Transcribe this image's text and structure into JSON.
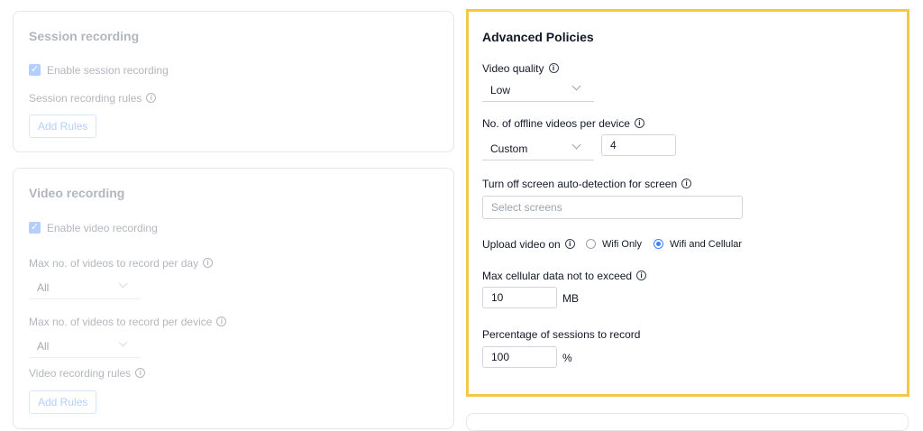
{
  "session_recording": {
    "title": "Session recording",
    "enable_label": "Enable session recording",
    "rules_label": "Session recording rules",
    "add_rules_label": "Add Rules"
  },
  "video_recording": {
    "title": "Video recording",
    "enable_label": "Enable video recording",
    "max_per_day_label": "Max no. of videos to record per day",
    "max_per_day_value": "All",
    "max_per_device_label": "Max no. of videos to record per device",
    "max_per_device_value": "All",
    "rules_label": "Video recording rules",
    "add_rules_label": "Add Rules"
  },
  "advanced": {
    "title": "Advanced Policies",
    "video_quality_label": "Video quality",
    "video_quality_value": "Low",
    "offline_videos_label": "No. of offline videos per device",
    "offline_videos_mode": "Custom",
    "offline_videos_count": "4",
    "screen_detection_label": "Turn off screen auto-detection for screen",
    "screen_detection_placeholder": "Select screens",
    "upload_label": "Upload video on",
    "upload_options": [
      "Wifi Only",
      "Wifi and Cellular"
    ],
    "upload_selected": "Wifi and Cellular",
    "cellular_label": "Max cellular data not to exceed",
    "cellular_value": "10",
    "cellular_unit": "MB",
    "sessions_label": "Percentage of sessions to record",
    "sessions_value": "100",
    "sessions_unit": "%"
  },
  "colors": {
    "accent": "#3b82f6",
    "highlight": "#f4c842"
  }
}
